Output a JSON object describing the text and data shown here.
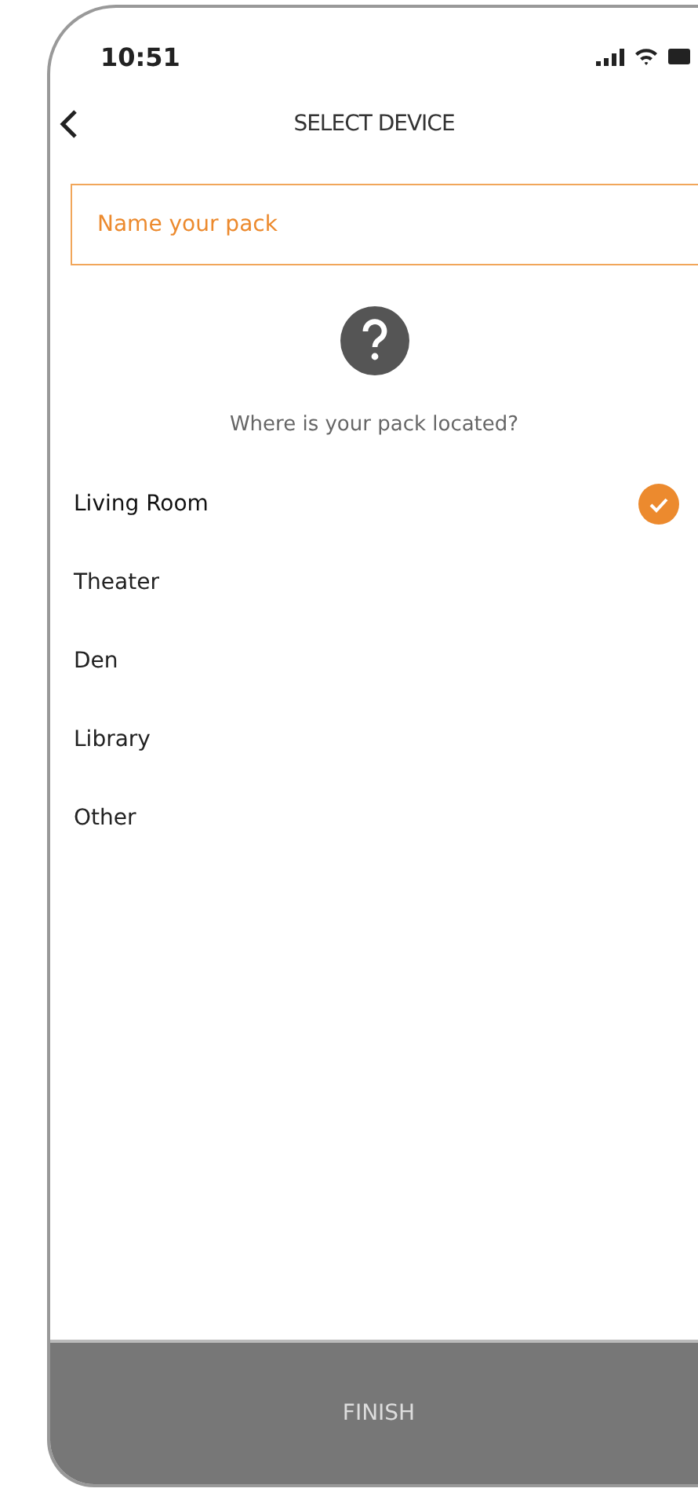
{
  "status_bar": {
    "time": "10:51"
  },
  "header": {
    "title": "SELECT DEVICE"
  },
  "name_field": {
    "placeholder": "Name your pack"
  },
  "prompt": "Where is your pack located?",
  "locations": [
    {
      "label": "Living Room",
      "selected": true
    },
    {
      "label": "Theater",
      "selected": false
    },
    {
      "label": "Den",
      "selected": false
    },
    {
      "label": "Library",
      "selected": false
    },
    {
      "label": "Other",
      "selected": false
    }
  ],
  "finish_button": {
    "label": "FINISH"
  }
}
